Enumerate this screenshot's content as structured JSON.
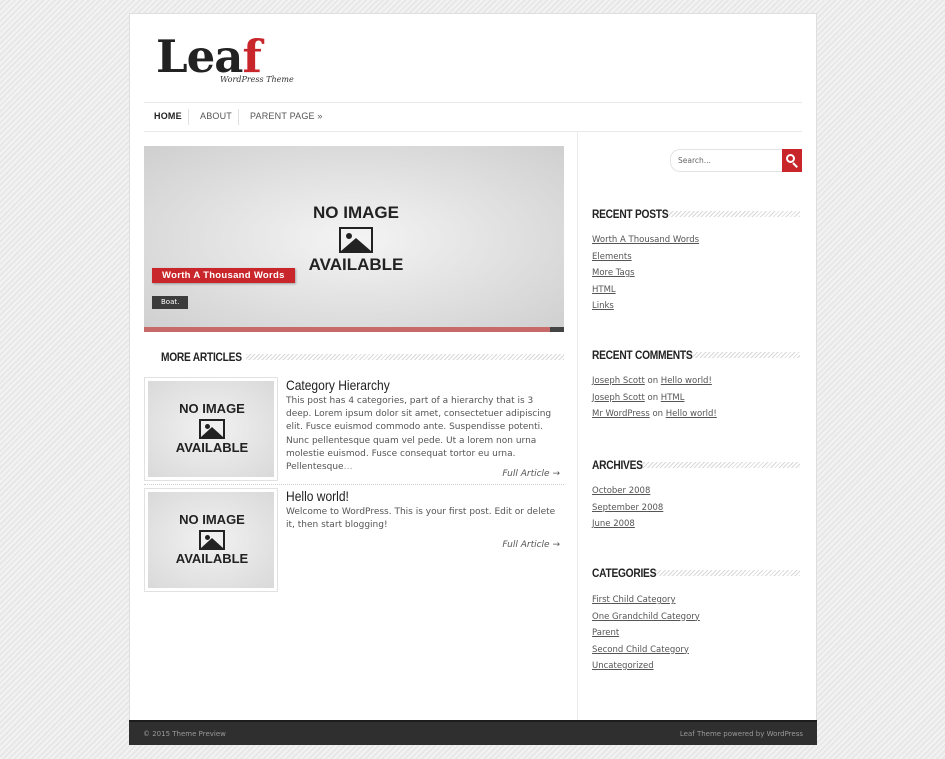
{
  "logo": {
    "text_main": "Lea",
    "text_accent": "f",
    "tagline": "WordPress Theme"
  },
  "nav": {
    "items": [
      "HOME",
      "ABOUT",
      "PARENT PAGE »"
    ]
  },
  "placeholder": {
    "line1": "NO IMAGE",
    "line2": "AVAILABLE"
  },
  "slider": {
    "title": "Worth A Thousand Words",
    "excerpt": "Boat.",
    "progress": 0.966
  },
  "more_articles": {
    "heading": "MORE ARTICLES",
    "items": [
      {
        "title": "Category Hierarchy",
        "excerpt": "This post has 4 categories, part of a hierarchy that is 3 deep. Lorem ipsum dolor sit amet, consectetuer adipiscing elit. Fusce euismod commodo ante. Suspendisse potenti. Nunc pellentesque quam vel pede. Ut a lorem non urna molestie euismod. Fusce consequat tortor eu urna. Pellentesque",
        "ellipsis": "…",
        "more": "Full Article →"
      },
      {
        "title": "Hello world!",
        "excerpt": "Welcome to WordPress. This is your first post. Edit or delete it, then start blogging!",
        "ellipsis": "",
        "more": "Full Article →"
      }
    ]
  },
  "search": {
    "placeholder": "Search..."
  },
  "sidebar": {
    "recent_posts": {
      "title": "RECENT POSTS",
      "items": [
        "Worth A Thousand Words",
        "Elements",
        "More Tags",
        "HTML",
        "Links"
      ]
    },
    "recent_comments": {
      "title": "RECENT COMMENTS",
      "items": [
        {
          "author": "Joseph Scott",
          "on": "on",
          "post": "Hello world!"
        },
        {
          "author": "Joseph Scott",
          "on": "on",
          "post": "HTML"
        },
        {
          "author": "Mr WordPress",
          "on": "on",
          "post": "Hello world!"
        }
      ]
    },
    "archives": {
      "title": "ARCHIVES",
      "items": [
        "October 2008",
        "September 2008",
        "June 2008"
      ]
    },
    "categories": {
      "title": "CATEGORIES",
      "items": [
        "First Child Category",
        "One Grandchild Category",
        "Parent",
        "Second Child Category",
        "Uncategorized"
      ]
    }
  },
  "footer": {
    "left": "© 2015 Theme Preview",
    "right": "Leaf Theme powered by WordPress"
  },
  "colors": {
    "accent": "#c8262b",
    "footer_bg": "#2f2f2f"
  }
}
